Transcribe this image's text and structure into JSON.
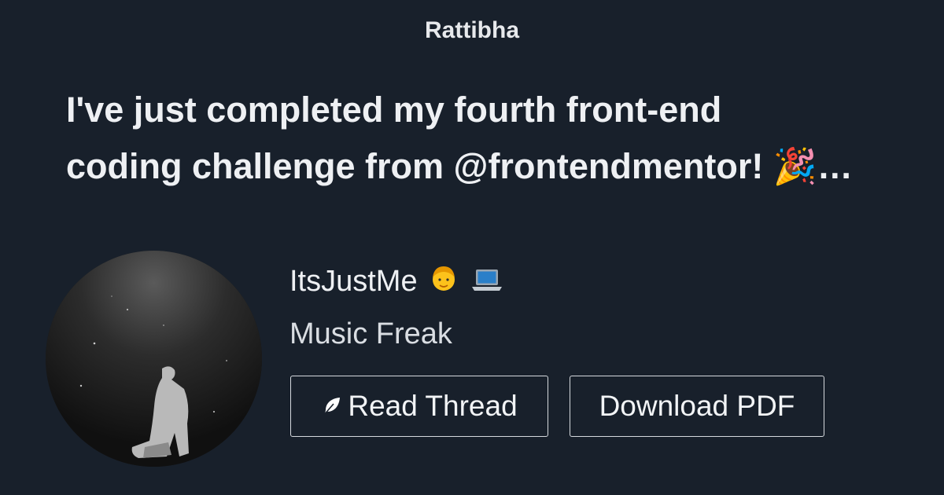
{
  "site": {
    "brand": "Rattibha"
  },
  "thread": {
    "title_line1": "I've just completed my fourth front-end",
    "title_line2": "coding challenge from @frontendmentor! 🎉…"
  },
  "author": {
    "name": "ItsJustMe",
    "bio": "Music Freak",
    "avatar_icon": "avatar-photo"
  },
  "actions": {
    "read_label": "Read Thread",
    "read_icon": "feather-icon",
    "download_label": "Download PDF"
  },
  "colors": {
    "background": "#18202b",
    "text": "#eef0f3",
    "button_border": "#d5d9de"
  }
}
